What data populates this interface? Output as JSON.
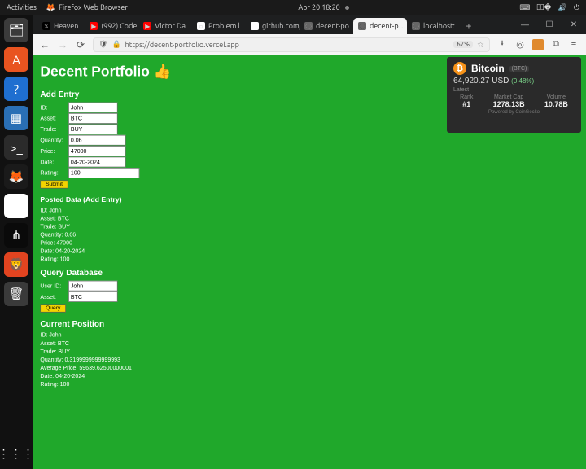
{
  "sysbar": {
    "activities": "Activities",
    "app": "Firefox Web Browser",
    "clock": "Apr 20  18:20"
  },
  "launcher": {
    "tiles": [
      {
        "name": "files",
        "bg": "#3b3b3b",
        "glyph": "🗂"
      },
      {
        "name": "software",
        "bg": "#e95420",
        "glyph": "A"
      },
      {
        "name": "help",
        "bg": "#1f6fd0",
        "glyph": "?"
      },
      {
        "name": "screenshot",
        "bg": "#2a6fb5",
        "glyph": "▦"
      },
      {
        "name": "terminal",
        "bg": "#2b2b2b",
        "glyph": ">_"
      },
      {
        "name": "firefox",
        "bg": "#1a1a1a",
        "glyph": "🦊"
      },
      {
        "name": "chrome",
        "bg": "#ffffff",
        "glyph": "◉"
      },
      {
        "name": "vscode",
        "bg": "#0a0a0a",
        "glyph": "⋔"
      },
      {
        "name": "brave",
        "bg": "#e24420",
        "glyph": "🦁"
      },
      {
        "name": "trash",
        "bg": "#3a3a3a",
        "glyph": "🗑"
      }
    ]
  },
  "tabs": [
    {
      "name": "tab-heaven",
      "favicon_bg": "#000",
      "favicon_glyph": "𝕏",
      "label": "Heaven"
    },
    {
      "name": "tab-992",
      "favicon_bg": "#f00",
      "favicon_glyph": "▶",
      "label": "(992) Code"
    },
    {
      "name": "tab-victor",
      "favicon_bg": "#f00",
      "favicon_glyph": "▶",
      "label": "Victor Da"
    },
    {
      "name": "tab-problem",
      "favicon_bg": "#fff",
      "favicon_glyph": "○",
      "label": "Problem l"
    },
    {
      "name": "tab-github",
      "favicon_bg": "#fff",
      "favicon_glyph": "",
      "label": "github.com/l"
    },
    {
      "name": "tab-decent1",
      "favicon_bg": "#666",
      "favicon_glyph": "◌",
      "label": "decent-po"
    },
    {
      "name": "tab-decent2",
      "favicon_bg": "#666",
      "favicon_glyph": "◌",
      "label": "decent-p…",
      "active": true,
      "closable": true
    },
    {
      "name": "tab-localhost",
      "favicon_bg": "#666",
      "favicon_glyph": "◌",
      "label": "localhost:"
    }
  ],
  "url": {
    "display": "https://decent-portfolio.vercel.app",
    "zoom": "67%"
  },
  "page": {
    "title": "Decent Portfolio 👍",
    "add_entry_heading": "Add Entry",
    "form": {
      "id_label": "ID:",
      "id_value": "John",
      "asset_label": "Asset:",
      "asset_value": "BTC",
      "trade_label": "Trade:",
      "trade_value": "BUY",
      "quantity_label": "Quantity:",
      "quantity_value": "0.06",
      "price_label": "Price:",
      "price_value": "47000",
      "date_label": "Date:",
      "date_value": "04-20-2024",
      "rating_label": "Rating:",
      "rating_value": "100",
      "submit": "Submit"
    },
    "posted_heading": "Posted Data (Add Entry)",
    "posted": {
      "id_l": "ID",
      "id_v": "John",
      "asset_l": "Asset",
      "asset_v": "BTC",
      "trade_l": "Trade",
      "trade_v": "BUY",
      "qty_l": "Quantity",
      "qty_v": "0.06",
      "price_l": "Price",
      "price_v": "47000",
      "date_l": "Date",
      "date_v": "04-20-2024",
      "rating_l": "Rating",
      "rating_v": "100"
    },
    "query_heading": "Query Database",
    "query": {
      "uid_label": "User ID:",
      "uid_value": "John",
      "asset_label": "Asset:",
      "asset_value": "BTC",
      "btn": "Query"
    },
    "pos_heading": "Current Position",
    "pos": {
      "id_l": "ID",
      "id_v": "John",
      "asset_l": "Asset",
      "asset_v": "BTC",
      "trade_l": "Trade",
      "trade_v": "BUY",
      "qty_l": "Quantity",
      "qty_v": "0.3199999999999993",
      "price_l": "Average Price",
      "price_v": "59639.62500000001",
      "date_l": "Date",
      "date_v": "04-20-2024",
      "rating_l": "Rating",
      "rating_v": "100"
    }
  },
  "widget": {
    "name": "Bitcoin",
    "symbol": "(BTC)",
    "price": "64,920.27 USD",
    "change": "(0.48%)",
    "latest": "Latest",
    "rank_l": "Rank",
    "rank_v": "#1",
    "cap_l": "Market Cap",
    "cap_v": "1278.13B",
    "vol_l": "Volume",
    "vol_v": "10.78B",
    "foot": "Powered by CoinGecko"
  }
}
